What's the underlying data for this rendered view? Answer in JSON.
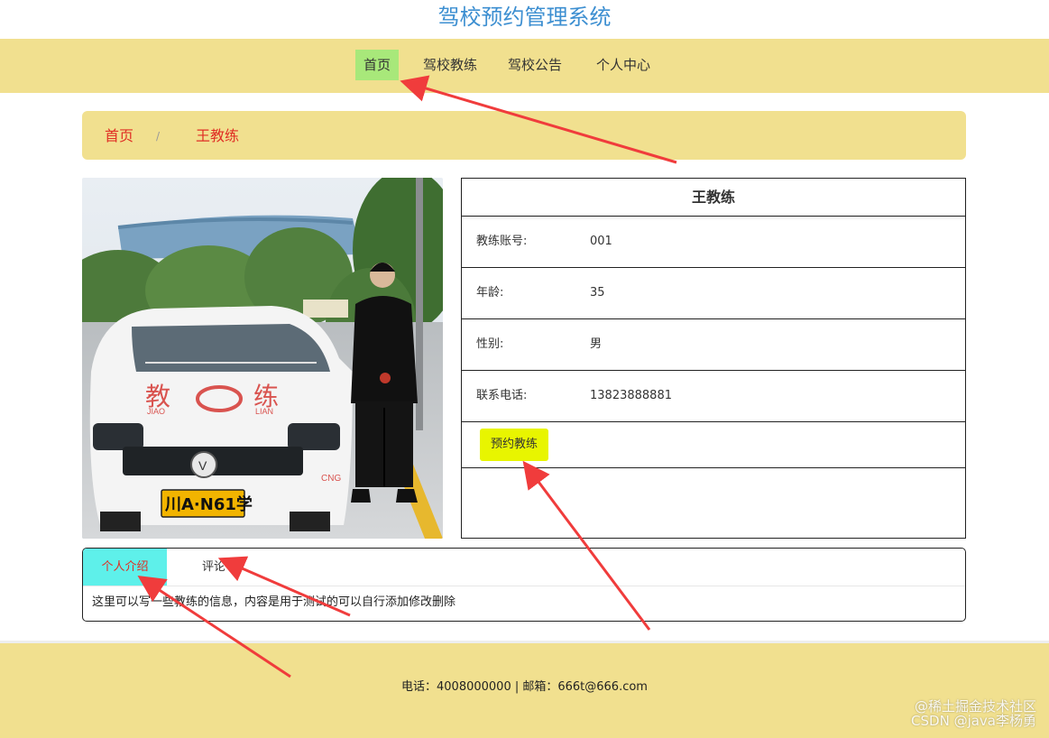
{
  "site": {
    "title": "驾校预约管理系统"
  },
  "nav": {
    "items": [
      {
        "label": "首页",
        "active": true
      },
      {
        "label": "驾校教练"
      },
      {
        "label": "驾校公告"
      },
      {
        "label": "个人中心"
      }
    ]
  },
  "breadcrumb": {
    "home": "首页",
    "separator": "/",
    "current": "王教练"
  },
  "coach": {
    "name": "王教练",
    "fields": [
      {
        "label": "教练账号:",
        "value": "001"
      },
      {
        "label": "年龄:",
        "value": "35"
      },
      {
        "label": "性别:",
        "value": "男"
      },
      {
        "label": "联系电话:",
        "value": "13823888881"
      }
    ],
    "book_button": "预约教练",
    "photo": {
      "car_text": "教",
      "car_text2": "练",
      "car_pinyin1": "JIAO",
      "car_pinyin2": "LIAN",
      "plate": "川A·N61学",
      "cng": "CNG"
    }
  },
  "tabs": {
    "items": [
      {
        "label": "个人介绍",
        "active": true
      },
      {
        "label": "评论"
      }
    ],
    "content": "这里可以写一些教练的信息，内容是用于测试的可以自行添加修改删除"
  },
  "footer": {
    "text": "电话：4008000000 | 邮箱：666t@666.com"
  },
  "watermark": {
    "line1": "@稀土掘金技术社区",
    "line2": "CSDN @java李杨勇"
  },
  "colors": {
    "accent_yellow": "#f1e08f",
    "nav_active": "#a8e87a",
    "tab_active": "#5ef0ea",
    "button": "#e8f500",
    "link_red": "#e02e24",
    "title_blue": "#3d8fd1",
    "arrow_red": "#f03c3c"
  }
}
